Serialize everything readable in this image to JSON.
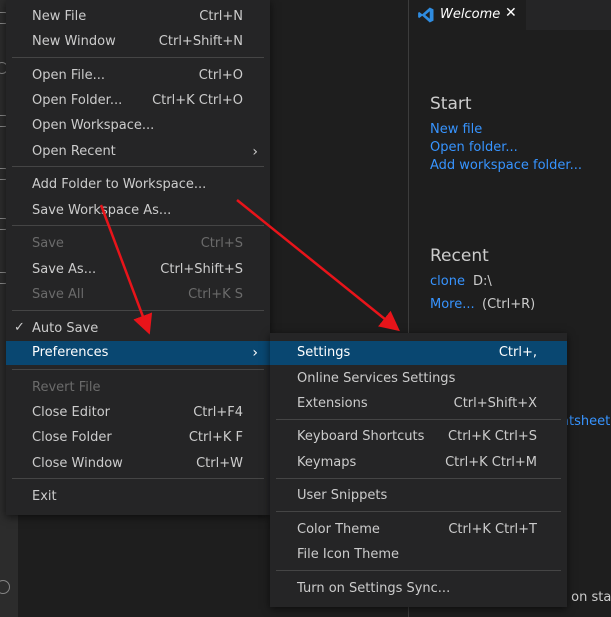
{
  "file_menu": {
    "new_file": {
      "label": "New File",
      "shortcut": "Ctrl+N"
    },
    "new_window": {
      "label": "New Window",
      "shortcut": "Ctrl+Shift+N"
    },
    "open_file": {
      "label": "Open File...",
      "shortcut": "Ctrl+O"
    },
    "open_folder": {
      "label": "Open Folder...",
      "shortcut": "Ctrl+K Ctrl+O"
    },
    "open_workspace": {
      "label": "Open Workspace..."
    },
    "open_recent": {
      "label": "Open Recent"
    },
    "add_folder": {
      "label": "Add Folder to Workspace..."
    },
    "save_workspace_as": {
      "label": "Save Workspace As..."
    },
    "save": {
      "label": "Save",
      "shortcut": "Ctrl+S"
    },
    "save_as": {
      "label": "Save As...",
      "shortcut": "Ctrl+Shift+S"
    },
    "save_all": {
      "label": "Save All",
      "shortcut": "Ctrl+K S"
    },
    "auto_save": {
      "label": "Auto Save",
      "checked": true
    },
    "preferences": {
      "label": "Preferences"
    },
    "revert_file": {
      "label": "Revert File"
    },
    "close_editor": {
      "label": "Close Editor",
      "shortcut": "Ctrl+F4"
    },
    "close_folder": {
      "label": "Close Folder",
      "shortcut": "Ctrl+K F"
    },
    "close_window": {
      "label": "Close Window",
      "shortcut": "Ctrl+W"
    },
    "exit": {
      "label": "Exit"
    }
  },
  "preferences_menu": {
    "settings": {
      "label": "Settings",
      "shortcut": "Ctrl+,"
    },
    "online_services": {
      "label": "Online Services Settings"
    },
    "extensions": {
      "label": "Extensions",
      "shortcut": "Ctrl+Shift+X"
    },
    "keyboard_shortcuts": {
      "label": "Keyboard Shortcuts",
      "shortcut": "Ctrl+K Ctrl+S"
    },
    "keymaps": {
      "label": "Keymaps",
      "shortcut": "Ctrl+K Ctrl+M"
    },
    "user_snippets": {
      "label": "User Snippets"
    },
    "color_theme": {
      "label": "Color Theme",
      "shortcut": "Ctrl+K Ctrl+T"
    },
    "file_icon_theme": {
      "label": "File Icon Theme"
    },
    "settings_sync": {
      "label": "Turn on Settings Sync..."
    }
  },
  "tab": {
    "label": "Welcome",
    "close": "✕"
  },
  "welcome": {
    "start_heading": "Start",
    "new_file": "New file",
    "open_folder": "Open folder...",
    "add_workspace_folder": "Add workspace folder...",
    "recent_heading": "Recent",
    "recent_item_name": "clone",
    "recent_item_path": "D:\\",
    "more_link": "More...",
    "more_shortcut": "(Ctrl+R)",
    "partial_cheatsheet": "atsheet",
    "partial_startup": "e on sta"
  },
  "colors": {
    "menu_bg": "#252526",
    "selection": "#094771",
    "link": "#3794ff",
    "annotation_arrow": "#e8141a"
  },
  "icons": {
    "vscode_logo": "vscode-logo-icon",
    "submenu_arrow": "chevron-right-icon",
    "checkmark": "check-icon"
  }
}
